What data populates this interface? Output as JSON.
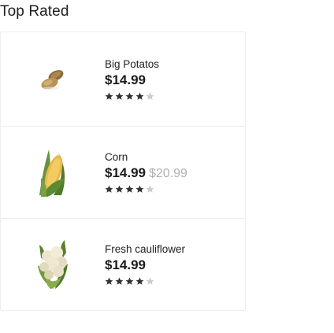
{
  "section": {
    "title": "Top Rated"
  },
  "colors": {
    "star_filled": "#333333",
    "star_empty": "#cccccc",
    "old_price": "#b0b0b0",
    "card_border": "#eeeeee"
  },
  "products": [
    {
      "name": "Big Potatos",
      "price": "$14.99",
      "old_price": "",
      "rating": 4,
      "rating_max": 5,
      "icon": "potato-icon"
    },
    {
      "name": "Corn",
      "price": "$14.99",
      "old_price": "$20.99",
      "rating": 4,
      "rating_max": 5,
      "icon": "corn-icon"
    },
    {
      "name": "Fresh cauliflower",
      "price": "$14.99",
      "old_price": "",
      "rating": 4,
      "rating_max": 5,
      "icon": "cauliflower-icon"
    }
  ]
}
